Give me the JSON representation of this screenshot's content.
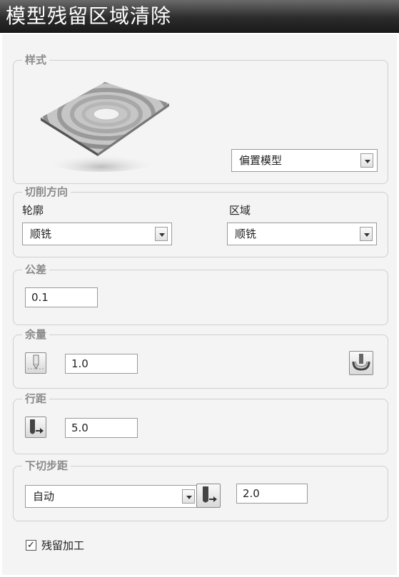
{
  "window": {
    "title": "模型残留区域清除"
  },
  "style_group": {
    "legend": "样式",
    "preview_icon": "offset-pattern-preview-icon",
    "pattern_select": {
      "value": "偏置模型"
    }
  },
  "cut_direction": {
    "legend": "切削方向",
    "profile": {
      "label": "轮廓",
      "value": "顺铣"
    },
    "area": {
      "label": "区域",
      "value": "顺铣"
    }
  },
  "tolerance": {
    "legend": "公差",
    "value": "0.1"
  },
  "allowance": {
    "legend": "余量",
    "value": "1.0",
    "left_icon": "component-allowance-icon",
    "right_icon": "surface-allowance-icon"
  },
  "stepover": {
    "legend": "行距",
    "value": "5.0",
    "icon": "tool-stepover-icon"
  },
  "stepdown": {
    "legend": "下切步距",
    "mode": "自动",
    "value": "2.0",
    "icon": "tool-stepdown-icon"
  },
  "rest_machining": {
    "label": "残留加工",
    "checked": true
  }
}
